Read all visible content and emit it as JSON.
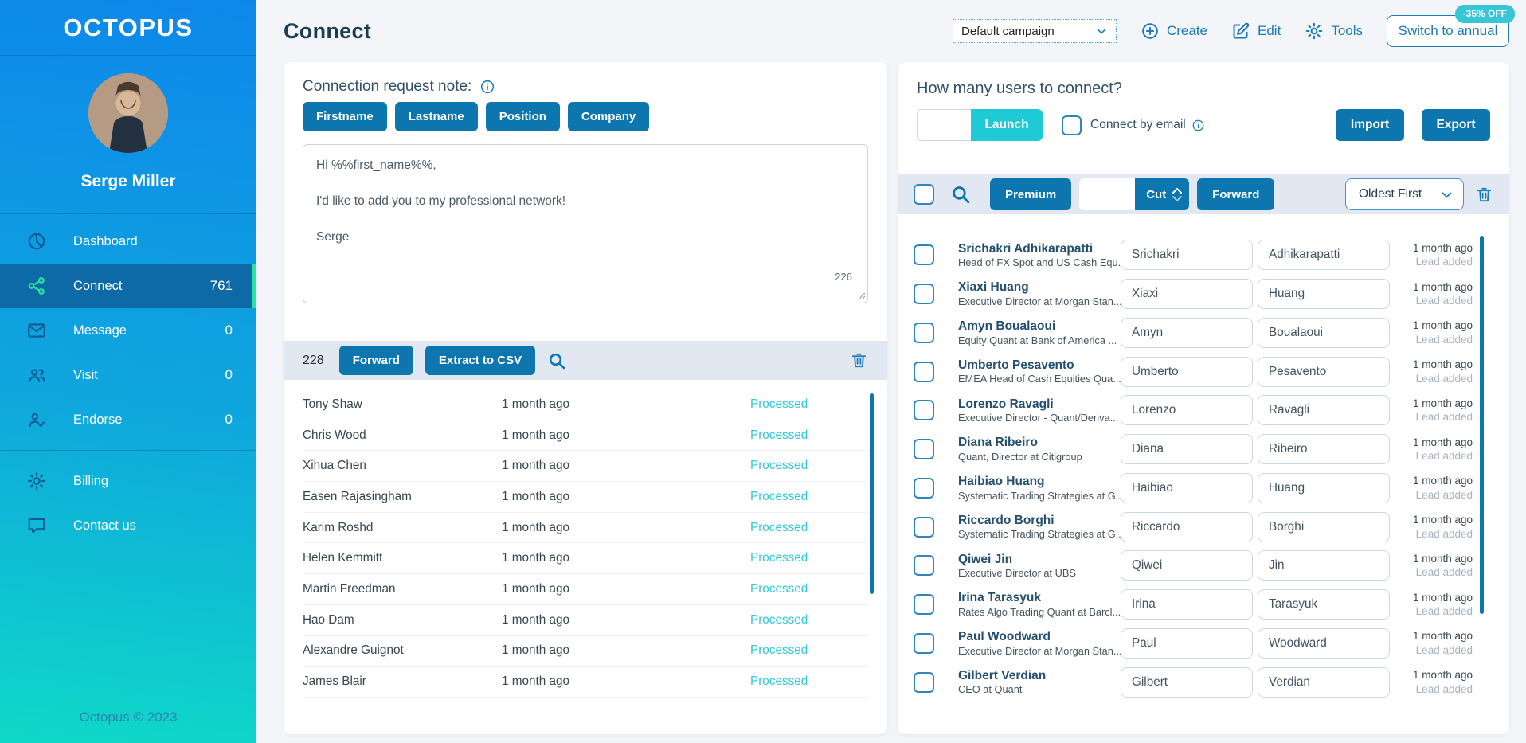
{
  "app": {
    "logo": "OCTOPUS",
    "footer": "Octopus © 2023"
  },
  "colors": {
    "accent_blue": "#0e76ae",
    "icon_blue": "#1b7ab8",
    "navy": "#1d3c55",
    "teal": "#1dcad5",
    "badge_teal": "#38c6d7",
    "green_accent": "#2be3a1",
    "processed_teal": "#2ec9d9",
    "sidebar_gradient_top": "#0d87eb",
    "sidebar_gradient_bottom": "#0fd9c8"
  },
  "sidebar": {
    "user_name": "Serge Miller",
    "nav": [
      {
        "label": "Dashboard",
        "count": "",
        "active": false
      },
      {
        "label": "Connect",
        "count": "761",
        "active": true
      },
      {
        "label": "Message",
        "count": "0",
        "active": false
      },
      {
        "label": "Visit",
        "count": "0",
        "active": false
      },
      {
        "label": "Endorse",
        "count": "0",
        "active": false
      }
    ],
    "secondary": [
      {
        "label": "Billing"
      },
      {
        "label": "Contact us"
      }
    ]
  },
  "header": {
    "title": "Connect",
    "campaign_select": "Default campaign",
    "actions": [
      {
        "label": "Create"
      },
      {
        "label": "Edit"
      },
      {
        "label": "Tools"
      }
    ],
    "switch_button": "Switch to annual",
    "discount_badge": "-35% OFF"
  },
  "note_card": {
    "title": "Connection request note:",
    "merge_buttons": [
      "Firstname",
      "Lastname",
      "Position",
      "Company"
    ],
    "message": "Hi %%first_name%%,\n\nI'd like to add you to my professional network!\n\nSerge",
    "char_count": "226",
    "toolbar": {
      "count": "228",
      "forward": "Forward",
      "extract": "Extract to CSV"
    },
    "rows": [
      {
        "name": "Tony Shaw",
        "time": "1 month ago",
        "status": "Processed"
      },
      {
        "name": "Chris Wood",
        "time": "1 month ago",
        "status": "Processed"
      },
      {
        "name": "Xihua Chen",
        "time": "1 month ago",
        "status": "Processed"
      },
      {
        "name": "Easen Rajasingham",
        "time": "1 month ago",
        "status": "Processed"
      },
      {
        "name": "Karim Roshd",
        "time": "1 month ago",
        "status": "Processed"
      },
      {
        "name": "Helen Kemmitt",
        "time": "1 month ago",
        "status": "Processed"
      },
      {
        "name": "Martin Freedman",
        "time": "1 month ago",
        "status": "Processed"
      },
      {
        "name": "Hao Dam",
        "time": "1 month ago",
        "status": "Processed"
      },
      {
        "name": "Alexandre Guignot",
        "time": "1 month ago",
        "status": "Processed"
      },
      {
        "name": "James Blair",
        "time": "1 month ago",
        "status": "Processed"
      }
    ]
  },
  "connect_panel": {
    "title": "How many users to connect?",
    "users_input_value": "",
    "launch": "Launch",
    "connect_by_email": "Connect by email",
    "import": "Import",
    "export": "Export",
    "filter": {
      "premium": "Premium",
      "cut_input_value": "",
      "cut": "Cut",
      "forward": "Forward",
      "sort": "Oldest First"
    },
    "users": [
      {
        "name": "Srichakri Adhikarapatti",
        "subtitle": "Head of FX Spot and US Cash Equ...",
        "first": "Srichakri",
        "last": "Adhikarapatti",
        "time": "1 month ago",
        "status": "Lead added"
      },
      {
        "name": "Xiaxi Huang",
        "subtitle": "Executive Director at Morgan Stan...",
        "first": "Xiaxi",
        "last": "Huang",
        "time": "1 month ago",
        "status": "Lead added"
      },
      {
        "name": "Amyn Boualaoui",
        "subtitle": "Equity Quant at Bank of America ...",
        "first": "Amyn",
        "last": "Boualaoui",
        "time": "1 month ago",
        "status": "Lead added"
      },
      {
        "name": "Umberto Pesavento",
        "subtitle": "EMEA Head of Cash Equities Qua...",
        "first": "Umberto",
        "last": "Pesavento",
        "time": "1 month ago",
        "status": "Lead added"
      },
      {
        "name": "Lorenzo Ravagli",
        "subtitle": "Executive Director - Quant/Deriva...",
        "first": "Lorenzo",
        "last": "Ravagli",
        "time": "1 month ago",
        "status": "Lead added"
      },
      {
        "name": "Diana Ribeiro",
        "subtitle": "Quant, Director at Citigroup",
        "first": "Diana",
        "last": "Ribeiro",
        "time": "1 month ago",
        "status": "Lead added"
      },
      {
        "name": "Haibiao Huang",
        "subtitle": "Systematic Trading Strategies at G...",
        "first": "Haibiao",
        "last": "Huang",
        "time": "1 month ago",
        "status": "Lead added"
      },
      {
        "name": "Riccardo Borghi",
        "subtitle": "Systematic Trading Strategies at G...",
        "first": "Riccardo",
        "last": "Borghi",
        "time": "1 month ago",
        "status": "Lead added"
      },
      {
        "name": "Qiwei Jin",
        "subtitle": "Executive Director at UBS",
        "first": "Qiwei",
        "last": "Jin",
        "time": "1 month ago",
        "status": "Lead added"
      },
      {
        "name": "Irina Tarasyuk",
        "subtitle": "Rates Algo Trading Quant at Barcl...",
        "first": "Irina",
        "last": "Tarasyuk",
        "time": "1 month ago",
        "status": "Lead added"
      },
      {
        "name": "Paul Woodward",
        "subtitle": "Executive Director at Morgan Stan...",
        "first": "Paul",
        "last": "Woodward",
        "time": "1 month ago",
        "status": "Lead added"
      },
      {
        "name": "Gilbert Verdian",
        "subtitle": "CEO at Quant",
        "first": "Gilbert",
        "last": "Verdian",
        "time": "1 month ago",
        "status": "Lead added"
      }
    ]
  }
}
